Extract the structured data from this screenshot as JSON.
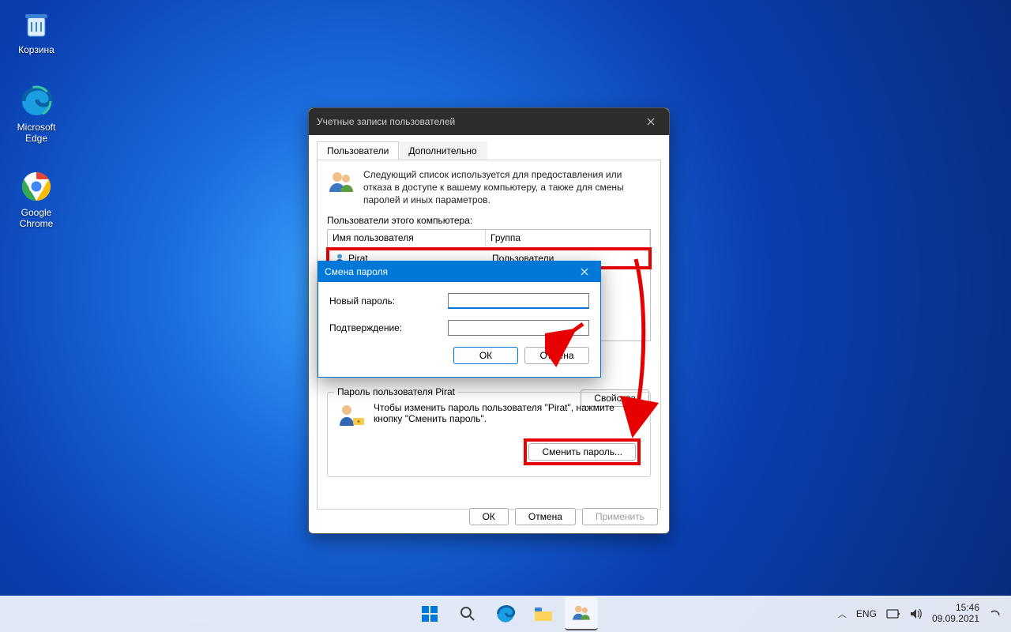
{
  "desktop": {
    "recycle": "Корзина",
    "edge": "Microsoft Edge",
    "chrome": "Google Chrome"
  },
  "win1": {
    "title": "Учетные записи пользователей",
    "tab_users": "Пользователи",
    "tab_advanced": "Дополнительно",
    "intro": "Следующий список используется для предоставления или отказа в доступе к вашему компьютеру, а также для смены паролей и иных параметров.",
    "users_label": "Пользователи этого компьютера:",
    "col_user": "Имя пользователя",
    "col_group": "Группа",
    "row_user": "Pirat",
    "row_group": "Пользователи",
    "properties_btn": "Свойства",
    "pw_group_legend": "Пароль пользователя Pirat",
    "pw_text": "Чтобы изменить пароль пользователя \"Pirat\", нажмите кнопку \"Сменить пароль\".",
    "change_pw_btn": "Сменить пароль...",
    "ok": "ОК",
    "cancel": "Отмена",
    "apply": "Применить"
  },
  "win2": {
    "title": "Смена пароля",
    "new_pw": "Новый пароль:",
    "confirm": "Подтверждение:",
    "ok": "ОК",
    "cancel": "Отмена"
  },
  "taskbar": {
    "lang": "ENG",
    "time": "15:46",
    "date": "09.09.2021"
  }
}
